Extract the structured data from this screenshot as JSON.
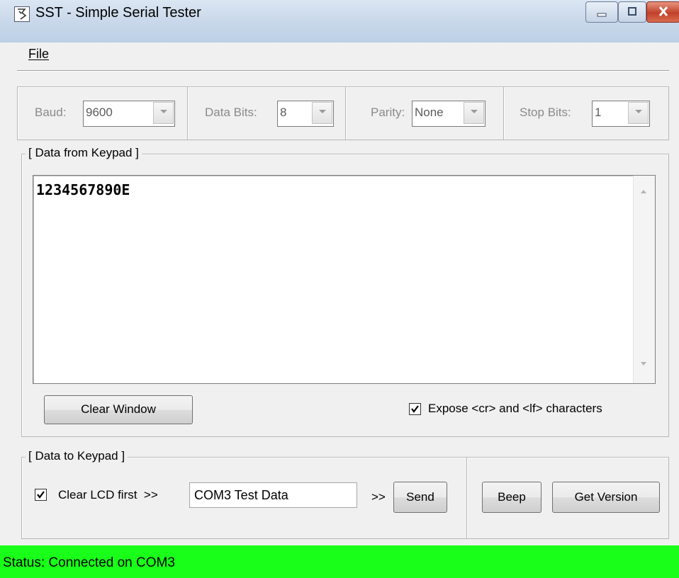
{
  "window": {
    "title": "SST - Simple Serial Tester",
    "icon": "serial-app-icon",
    "controls": [
      "minimize-icon",
      "maximize-icon",
      "close-icon"
    ]
  },
  "menu": {
    "file": "File"
  },
  "settings": {
    "baud": {
      "label": "Baud:",
      "value": "9600"
    },
    "data_bits": {
      "label": "Data Bits:",
      "value": "8"
    },
    "parity": {
      "label": "Parity:",
      "value": "None"
    },
    "stop_bits": {
      "label": "Stop Bits:",
      "value": "1"
    }
  },
  "data_from_keypad": {
    "title": "[ Data from Keypad ]",
    "content": "1234567890E",
    "clear_button": "Clear Window",
    "expose_checkbox": {
      "label": "Expose <cr> and <lf> characters",
      "checked": true
    }
  },
  "data_to_keypad": {
    "title": "[ Data to Keypad ]",
    "clear_lcd_checkbox": {
      "label": "Clear LCD first  >>",
      "checked": true
    },
    "input_value": "COM3 Test Data",
    "arrow": ">>",
    "send_button": "Send",
    "beep_button": "Beep",
    "get_version_button": "Get Version"
  },
  "status": {
    "text": "Status: Connected on COM3",
    "color": "#19ff19"
  }
}
